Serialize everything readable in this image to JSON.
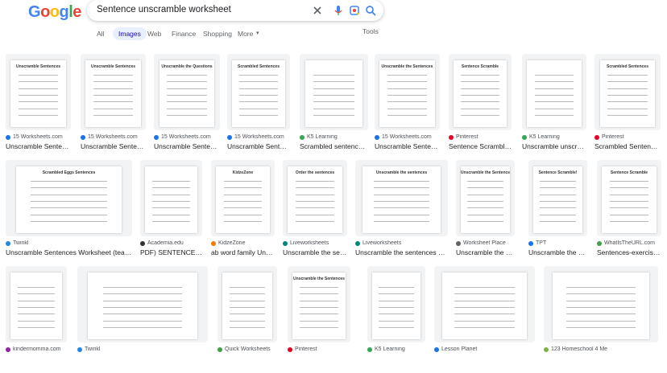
{
  "search": {
    "query": "Sentence unscramble worksheet"
  },
  "logo_letters": [
    {
      "ch": "G",
      "color": "#4285f4"
    },
    {
      "ch": "o",
      "color": "#ea4335"
    },
    {
      "ch": "o",
      "color": "#fbbc05"
    },
    {
      "ch": "g",
      "color": "#4285f4"
    },
    {
      "ch": "l",
      "color": "#34a853"
    },
    {
      "ch": "e",
      "color": "#ea4335"
    }
  ],
  "icons": {
    "clear": "close-icon",
    "voice": "mic-icon",
    "lens": "camera-icon",
    "search": "search-icon"
  },
  "tabs": [
    {
      "label": "All",
      "active": false
    },
    {
      "label": "Images",
      "active": true
    },
    {
      "label": "Web",
      "active": false
    },
    {
      "label": "Finance",
      "active": false
    },
    {
      "label": "Shopping",
      "active": false
    },
    {
      "label": "More",
      "active": false
    }
  ],
  "tools_label": "Tools",
  "results": [
    {
      "source": "15 Worksheets.com",
      "title": "Unscramble Senten…",
      "fav": "#1a73e8",
      "thumb": "Unscramble Sentences"
    },
    {
      "source": "15 Worksheets.com",
      "title": "Unscramble Senten…",
      "fav": "#1a73e8",
      "thumb": "Unscramble Sentences"
    },
    {
      "source": "15 Worksheets.com",
      "title": "Unscramble Senten…",
      "fav": "#1a73e8",
      "thumb": "Unscramble the Questions"
    },
    {
      "source": "15 Worksheets.com",
      "title": "Unscramble Senten…",
      "fav": "#1a73e8",
      "thumb": "Scrambled Sentences"
    },
    {
      "source": "K5 Learning",
      "title": "Scrambled sentenc…",
      "fav": "#34a853",
      "thumb": ""
    },
    {
      "source": "15 Worksheets.com",
      "title": "Unscramble Senten…",
      "fav": "#1a73e8",
      "thumb": "Unscramble the Sentences"
    },
    {
      "source": "Pinterest",
      "title": "Sentence Scramble …",
      "fav": "#e60023",
      "thumb": "Sentence Scramble"
    },
    {
      "source": "K5 Learning",
      "title": "Unscramble unscramb…",
      "fav": "#34a853",
      "thumb": ""
    },
    {
      "source": "Pinterest",
      "title": "Scrambled Senten…",
      "fav": "#e60023",
      "thumb": "Scrambled Sentences"
    },
    {
      "source": "Twinkl",
      "title": "Unscramble Sentences Worksheet (teach…",
      "fav": "#1e88e5",
      "thumb": "Scrambled Eggs Sentences"
    },
    {
      "source": "Academia.edu",
      "title": "PDF) SENTENCE…",
      "fav": "#333333",
      "thumb": ""
    },
    {
      "source": "KidzeZone",
      "title": "ab word family Uns…",
      "fav": "#f57c00",
      "thumb": "KidzeZone"
    },
    {
      "source": "Liveworksheets",
      "title": "Unscramble the se…",
      "fav": "#00897b",
      "thumb": "Order the sentences"
    },
    {
      "source": "Liveworksheets",
      "title": "Unscramble the sentences onli…",
      "fav": "#00897b",
      "thumb": "Unscramble the sentences"
    },
    {
      "source": "Worksheet Place",
      "title": "Unscramble the Se…",
      "fav": "#5f6368",
      "thumb": "Unscramble the Sentence"
    },
    {
      "source": "TPT",
      "title": "Unscramble the Se…",
      "fav": "#1a73e8",
      "thumb": "Sentence Scramble!"
    },
    {
      "source": "WhatIsTheURL.com",
      "title": "Sentences-exercis…",
      "fav": "#43a047",
      "thumb": "Sentence Scramble"
    },
    {
      "source": "kindermomma.com",
      "title": "",
      "fav": "#8e24aa",
      "thumb": ""
    },
    {
      "source": "Twinkl",
      "title": "",
      "fav": "#1e88e5",
      "thumb": ""
    },
    {
      "source": "Quick Worksheets",
      "title": "",
      "fav": "#43a047",
      "thumb": ""
    },
    {
      "source": "Pinterest",
      "title": "",
      "fav": "#e60023",
      "thumb": "Unscramble the Sentences"
    },
    {
      "source": "K5 Learning",
      "title": "",
      "fav": "#34a853",
      "thumb": ""
    },
    {
      "source": "Lesson Planet",
      "title": "",
      "fav": "#1a73e8",
      "thumb": ""
    },
    {
      "source": "123 Homeschool 4 Me",
      "title": "",
      "fav": "#7cb342",
      "thumb": ""
    }
  ]
}
